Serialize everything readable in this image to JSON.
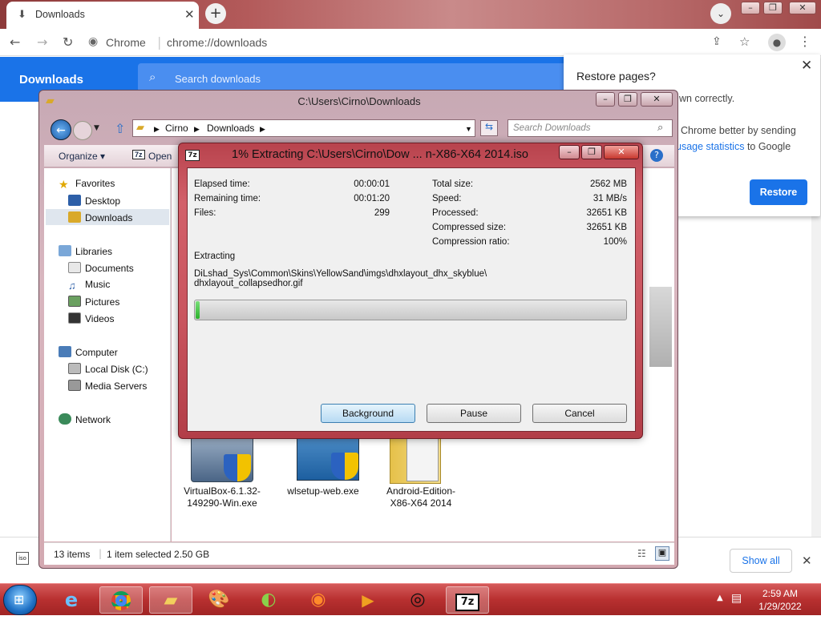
{
  "chrome": {
    "tab_title": "Downloads",
    "omnibox_site": "Chrome",
    "omnibox_url": "chrome://downloads",
    "page_title": "Downloads",
    "search_placeholder": "Search downloads",
    "show_all": "Show all"
  },
  "restore_popup": {
    "title": "Restore pages?",
    "line1": "wn correctly.",
    "line2": "Chrome better by sending",
    "line3_link": "usage statistics",
    "line3_rest": " to Google",
    "button": "Restore"
  },
  "explorer": {
    "title": "C:\\Users\\Cirno\\Downloads",
    "address_parts": [
      "Cirno",
      "Downloads"
    ],
    "search_placeholder": "Search Downloads",
    "commands": {
      "organize": "Organize ▾",
      "open": "Open"
    },
    "nav": {
      "favorites": "Favorites",
      "desktop": "Desktop",
      "downloads": "Downloads",
      "libraries": "Libraries",
      "documents": "Documents",
      "music": "Music",
      "pictures": "Pictures",
      "videos": "Videos",
      "computer": "Computer",
      "local_disk": "Local Disk (C:)",
      "media_servers": "Media Servers",
      "network": "Network"
    },
    "files": [
      {
        "name1": "VirtualBox-6.1.32-",
        "name2": "149290-Win.exe"
      },
      {
        "name1": "wlsetup-web.exe",
        "name2": ""
      },
      {
        "name1": "Android-Edition-",
        "name2": "X86-X64 2014"
      }
    ],
    "status_items": "13 items",
    "status_selected": "1 item selected  2.50 GB"
  },
  "dialog": {
    "title": "1% Extracting C:\\Users\\Cirno\\Dow ... n-X86-X64 2014.iso",
    "badge": "7z",
    "elapsed_label": "Elapsed time:",
    "elapsed_value": "00:00:01",
    "remaining_label": "Remaining time:",
    "remaining_value": "00:01:20",
    "files_label": "Files:",
    "files_value": "299",
    "total_label": "Total size:",
    "total_value": "2562 MB",
    "speed_label": "Speed:",
    "speed_value": "31 MB/s",
    "processed_label": "Processed:",
    "processed_value": "32651 KB",
    "compressed_label": "Compressed size:",
    "compressed_value": "32651 KB",
    "ratio_label": "Compression ratio:",
    "ratio_value": "100%",
    "extracting_label": "Extracting",
    "path_line1": "DiLshad_Sys\\Common\\Skins\\YellowSand\\imgs\\dhxlayout_dhx_skyblue\\",
    "path_line2": "dhxlayout_collapsedhor.gif",
    "progress_percent": 1,
    "buttons": {
      "background": "Background",
      "pause": "Pause",
      "cancel": "Cancel"
    }
  },
  "taskbar": {
    "time": "2:59 AM",
    "date": "1/29/2022",
    "sevenzip_label": "7z"
  },
  "colors": {
    "chrome_blue": "#1a73e8",
    "aero_red": "#c9545e",
    "progress_green": "#29b029"
  }
}
